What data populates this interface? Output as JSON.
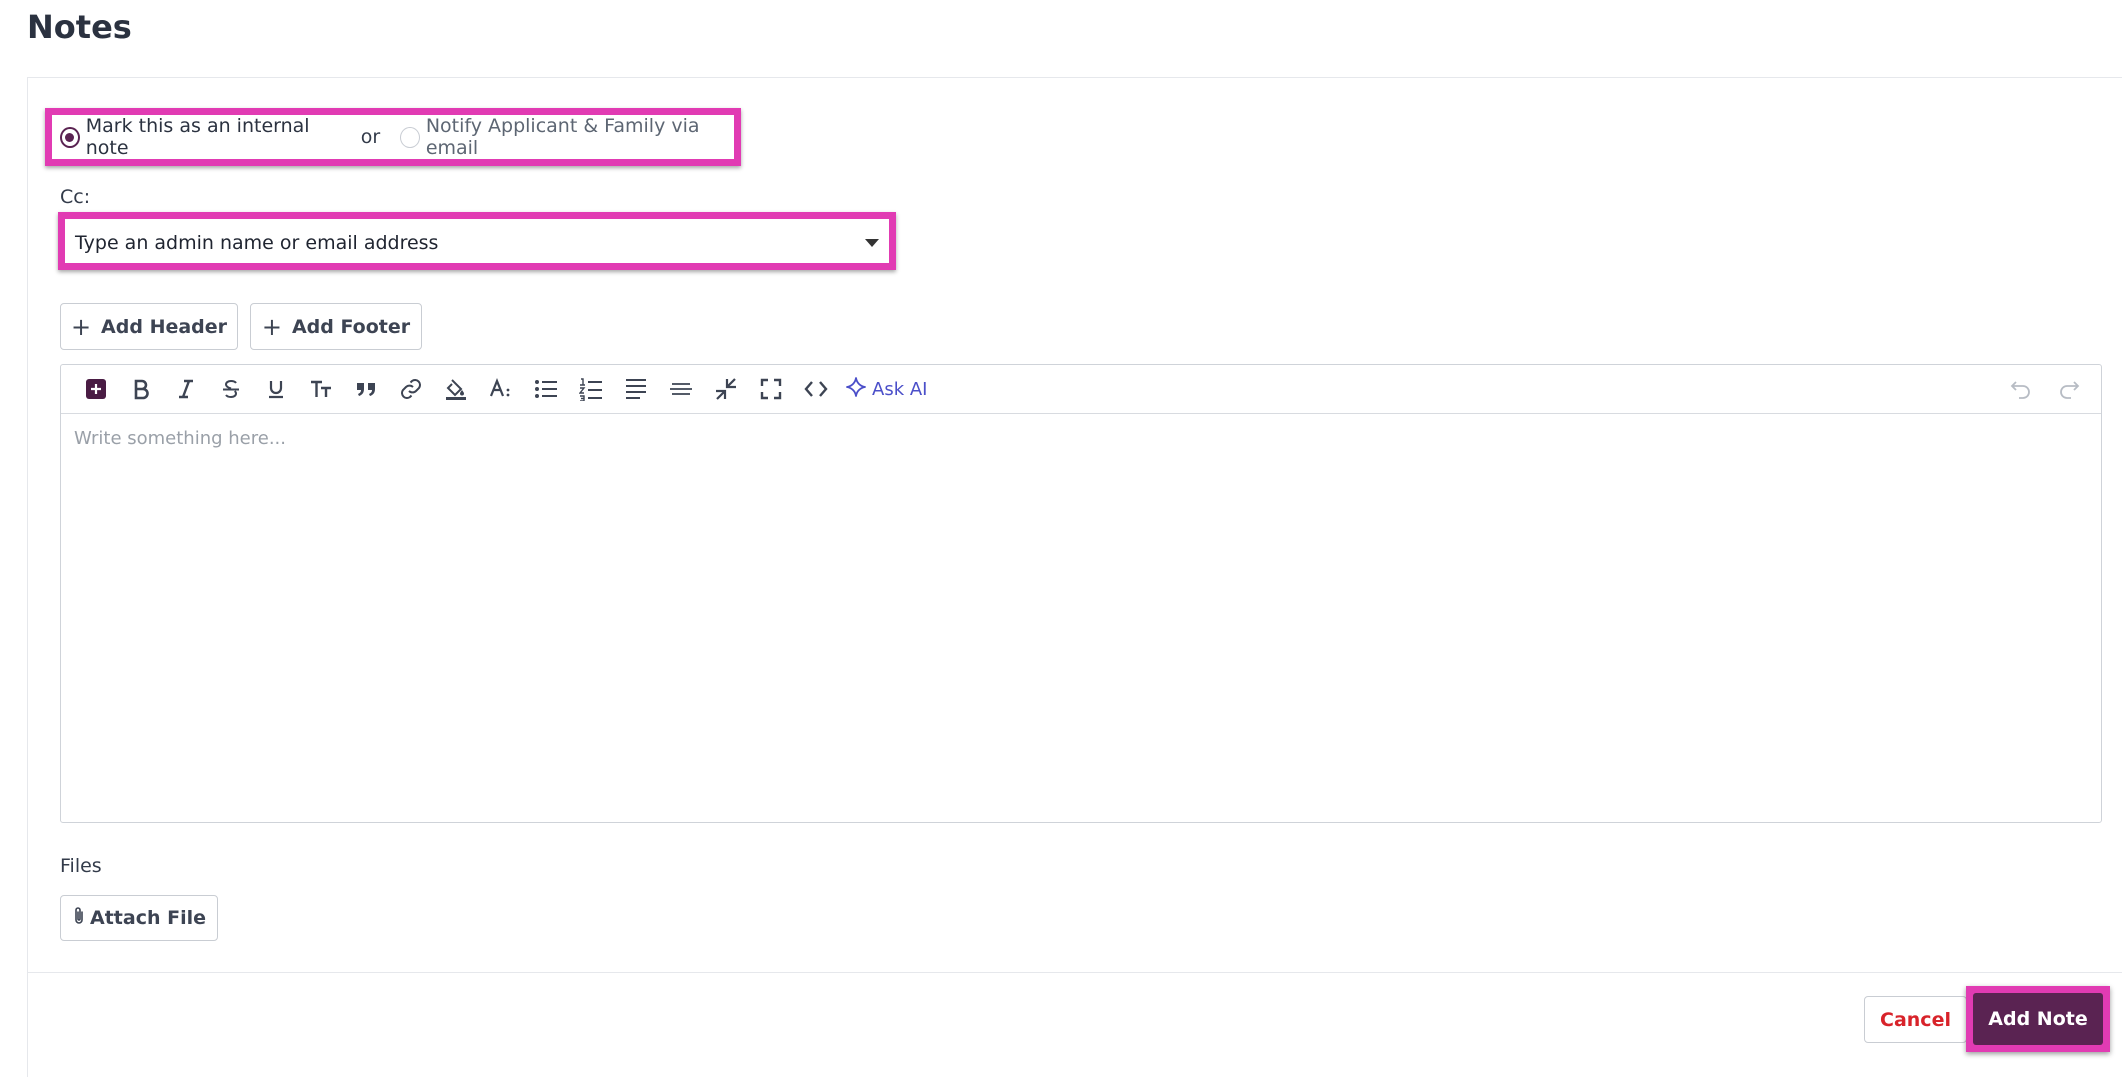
{
  "page": {
    "title": "Notes"
  },
  "note_type": {
    "internal_label": "Mark this as an internal note",
    "or_text": "or",
    "notify_label": "Notify Applicant & Family via email",
    "selected": "internal"
  },
  "cc": {
    "label": "Cc:",
    "placeholder": "Type an admin name or email address"
  },
  "buttons": {
    "add_header": "Add Header",
    "add_footer": "Add Footer",
    "attach_file": "Attach File",
    "cancel": "Cancel",
    "add_note": "Add Note"
  },
  "editor": {
    "placeholder": "Write something here...",
    "ask_ai_label": "Ask AI",
    "toolbar_icons": [
      "insert-icon",
      "bold-icon",
      "italic-icon",
      "strikethrough-icon",
      "underline-icon",
      "font-size-icon",
      "blockquote-icon",
      "link-icon",
      "highlight-icon",
      "font-style-icon",
      "bullet-list-icon",
      "numbered-list-icon",
      "align-icon",
      "horizontal-rule-icon",
      "collapse-icon",
      "fullscreen-icon",
      "code-icon",
      "sparkle-icon",
      "undo-icon",
      "redo-icon"
    ]
  },
  "files": {
    "label": "Files"
  },
  "colors": {
    "brand": "#5a2352",
    "highlight": "#e13bb3",
    "danger": "#d8232a",
    "ai_accent": "#4b4fc9"
  }
}
